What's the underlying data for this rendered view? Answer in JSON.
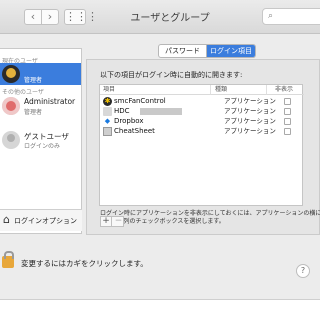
{
  "window": {
    "title": "ユーザとグループ"
  },
  "toolbar": {
    "back_glyph": "‹",
    "forward_glyph": "›",
    "grid_glyph": "⋮⋮⋮",
    "search_glyph": "⌕",
    "search_placeholder": ""
  },
  "sidebar": {
    "current_user_heading": "現在のユーザ",
    "other_users_heading": "その他のユーザ",
    "users": [
      {
        "name": "",
        "role": "管理者",
        "selected": true,
        "avatar": "user-avatar-icon"
      },
      {
        "name": "",
        "role": "",
        "selected": false,
        "avatar": "user-avatar-icon"
      },
      {
        "name": "Administrator",
        "role": "管理者",
        "selected": false,
        "avatar": "user-avatar-icon"
      },
      {
        "name": "ゲストユーザ",
        "role": "ログインのみ",
        "selected": false,
        "avatar": "guest-avatar-icon"
      }
    ],
    "login_options_label": "ログインオプション"
  },
  "tabs": {
    "password": "パスワード",
    "login_items": "ログイン項目",
    "active": "login_items"
  },
  "login_items": {
    "intro": "以下の項目がログイン時に自動的に開きます:",
    "columns": {
      "item": "項目",
      "kind": "種類",
      "hide": "非表示"
    },
    "rows": [
      {
        "name": "smcFanControl",
        "kind": "アプリケーション",
        "hidden": false,
        "icon": "smcfancontrol-icon"
      },
      {
        "name": "HDC",
        "kind": "アプリケーション",
        "hidden": false,
        "icon": "hdc-icon"
      },
      {
        "name": "Dropbox",
        "kind": "アプリケーション",
        "hidden": false,
        "icon": "dropbox-icon"
      },
      {
        "name": "CheatSheet",
        "kind": "アプリケーション",
        "hidden": false,
        "icon": "cheatsheet-icon"
      }
    ],
    "note_line1": "ログイン時にアプリケーションを非表示にしておくには、アプリケーションの横にある",
    "note_line2": "\"非表示\"列のチェックボックスを選択します。",
    "add_label": "+",
    "remove_label": "−"
  },
  "lock": {
    "text": "変更するにはカギをクリックします。"
  },
  "help": {
    "label": "?"
  },
  "colors": {
    "accent": "#3b7ddd",
    "lock": "#e8a73a"
  }
}
